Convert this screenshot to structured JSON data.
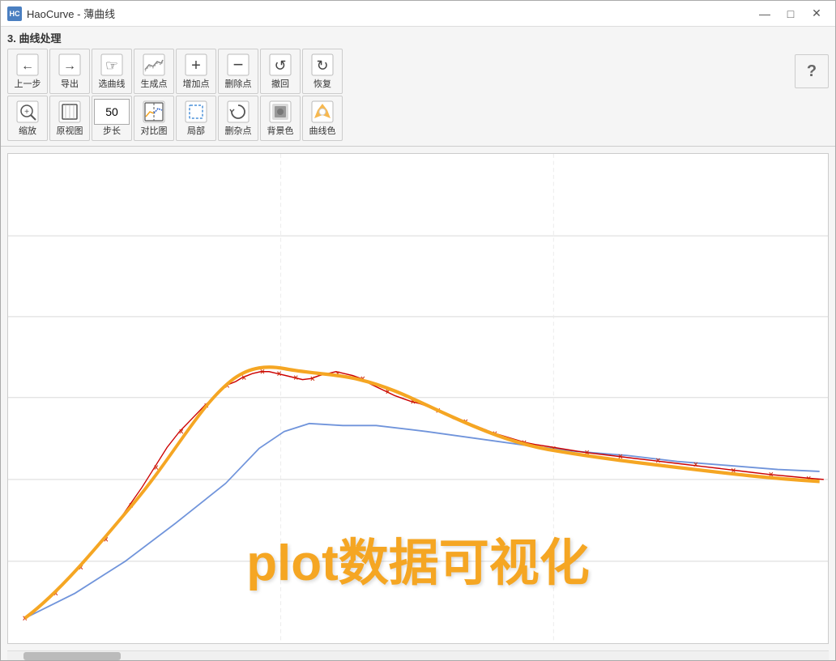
{
  "window": {
    "title": "HaoCurve - 薄曲线",
    "logo_text": "HC"
  },
  "title_controls": {
    "minimize": "—",
    "maximize": "□",
    "close": "✕"
  },
  "section": {
    "title": "3. 曲线处理"
  },
  "toolbar_row1": [
    {
      "id": "back",
      "icon": "←",
      "label": "上一步"
    },
    {
      "id": "export",
      "icon": "→",
      "label": "导出"
    },
    {
      "id": "select-curve",
      "icon": "☞",
      "label": "选曲线"
    },
    {
      "id": "generate-points",
      "icon": "∿",
      "label": "生成点"
    },
    {
      "id": "add-point",
      "icon": "+",
      "label": "增加点"
    },
    {
      "id": "delete-point",
      "icon": "−",
      "label": "删除点"
    },
    {
      "id": "undo",
      "icon": "↺",
      "label": "撤回"
    },
    {
      "id": "redo",
      "icon": "↻",
      "label": "恢复"
    }
  ],
  "toolbar_row2": [
    {
      "id": "zoom",
      "icon": "⊕",
      "label": "缩放"
    },
    {
      "id": "original",
      "icon": "⊡",
      "label": "原视图"
    },
    {
      "id": "step",
      "icon": "50",
      "label": "步长",
      "is_input": true
    },
    {
      "id": "compare",
      "icon": "◱",
      "label": "对比图"
    },
    {
      "id": "partial",
      "icon": "⬚",
      "label": "局部"
    },
    {
      "id": "clear-points",
      "icon": "⟳",
      "label": "删杂点"
    },
    {
      "id": "bg-color",
      "icon": "▣",
      "label": "背景色"
    },
    {
      "id": "curve-color",
      "icon": "◈",
      "label": "曲线色"
    }
  ],
  "help_label": "?",
  "chart": {
    "grid_lines": 6,
    "watermark": "plot数据可视化",
    "orange_curve": "main bezier curve in orange",
    "red_curve": "original data points in red/dark",
    "blue_line": "reference line in blue"
  },
  "colors": {
    "orange": "#f5a623",
    "red": "#cc0000",
    "blue": "#3366cc",
    "dark_red": "#990000"
  }
}
